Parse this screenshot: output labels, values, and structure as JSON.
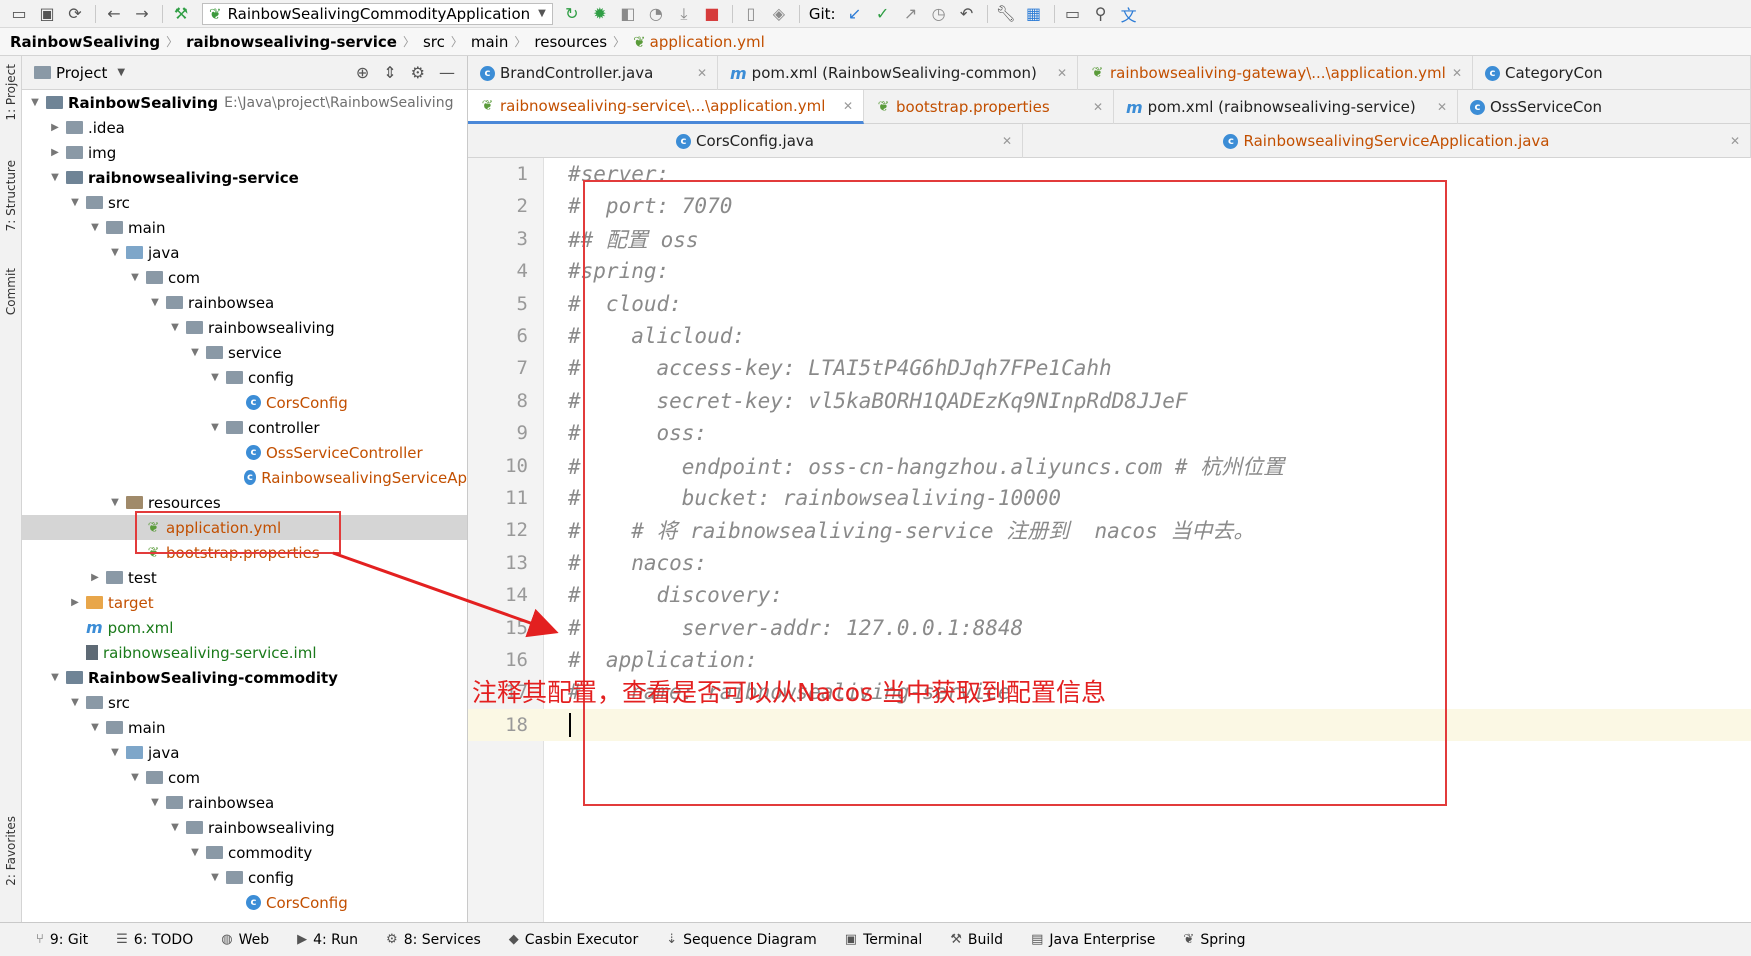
{
  "toolbar": {
    "run_config": "RainbowSealivingCommodityApplication",
    "git_label": "Git:"
  },
  "breadcrumb": [
    "RainbowSealiving",
    "raibnowsealiving-service",
    "src",
    "main",
    "resources",
    "application.yml"
  ],
  "left_stripe": {
    "project": "1: Project",
    "structure": "7: Structure",
    "commit": "Commit",
    "favorites": "2: Favorites"
  },
  "project_panel": {
    "title": "Project",
    "tree": [
      {
        "label": "RainbowSealiving",
        "path": "E:\\Java\\project\\RainbowSealiving",
        "level": 0,
        "arrow": "down",
        "icon": "module-folder",
        "style": "bold"
      },
      {
        "label": ".idea",
        "level": 1,
        "arrow": "right",
        "icon": "folder"
      },
      {
        "label": "img",
        "level": 1,
        "arrow": "right",
        "icon": "folder"
      },
      {
        "label": "raibnowsealiving-service",
        "level": 1,
        "arrow": "down",
        "icon": "module-folder",
        "style": "bold"
      },
      {
        "label": "src",
        "level": 2,
        "arrow": "down",
        "icon": "folder"
      },
      {
        "label": "main",
        "level": 3,
        "arrow": "down",
        "icon": "folder"
      },
      {
        "label": "java",
        "level": 4,
        "arrow": "down",
        "icon": "src-folder"
      },
      {
        "label": "com",
        "level": 5,
        "arrow": "down",
        "icon": "folder"
      },
      {
        "label": "rainbowsea",
        "level": 6,
        "arrow": "down",
        "icon": "folder"
      },
      {
        "label": "rainbowsealiving",
        "level": 7,
        "arrow": "down",
        "icon": "folder"
      },
      {
        "label": "service",
        "level": 8,
        "arrow": "down",
        "icon": "folder"
      },
      {
        "label": "config",
        "level": 9,
        "arrow": "down",
        "icon": "folder"
      },
      {
        "label": "CorsConfig",
        "level": 10,
        "arrow": "",
        "icon": "class",
        "style": "orange"
      },
      {
        "label": "controller",
        "level": 9,
        "arrow": "down",
        "icon": "folder"
      },
      {
        "label": "OssServiceController",
        "level": 10,
        "arrow": "",
        "icon": "class",
        "style": "orange"
      },
      {
        "label": "RainbowsealivingServiceAp",
        "level": 10,
        "arrow": "",
        "icon": "class",
        "style": "orange"
      },
      {
        "label": "resources",
        "level": 4,
        "arrow": "down",
        "icon": "res-folder"
      },
      {
        "label": "application.yml",
        "level": 5,
        "arrow": "",
        "icon": "yml",
        "style": "orange",
        "selected": true
      },
      {
        "label": "bootstrap.properties",
        "level": 5,
        "arrow": "",
        "icon": "yml",
        "style": "orange"
      },
      {
        "label": "test",
        "level": 3,
        "arrow": "right",
        "icon": "folder"
      },
      {
        "label": "target",
        "level": 2,
        "arrow": "right",
        "icon": "target-folder",
        "style": "brown"
      },
      {
        "label": "pom.xml",
        "level": 2,
        "arrow": "",
        "icon": "maven",
        "style": "green"
      },
      {
        "label": "raibnowsealiving-service.iml",
        "level": 2,
        "arrow": "",
        "icon": "iml",
        "style": "green"
      },
      {
        "label": "RainbowSealiving-commodity",
        "level": 1,
        "arrow": "down",
        "icon": "module-folder",
        "style": "bold"
      },
      {
        "label": "src",
        "level": 2,
        "arrow": "down",
        "icon": "folder"
      },
      {
        "label": "main",
        "level": 3,
        "arrow": "down",
        "icon": "folder"
      },
      {
        "label": "java",
        "level": 4,
        "arrow": "down",
        "icon": "src-folder"
      },
      {
        "label": "com",
        "level": 5,
        "arrow": "down",
        "icon": "folder"
      },
      {
        "label": "rainbowsea",
        "level": 6,
        "arrow": "down",
        "icon": "folder"
      },
      {
        "label": "rainbowsealiving",
        "level": 7,
        "arrow": "down",
        "icon": "folder"
      },
      {
        "label": "commodity",
        "level": 8,
        "arrow": "down",
        "icon": "folder"
      },
      {
        "label": "config",
        "level": 9,
        "arrow": "down",
        "icon": "folder"
      },
      {
        "label": "CorsConfig",
        "level": 10,
        "arrow": "",
        "icon": "class",
        "style": "blue"
      }
    ]
  },
  "editor_tabs": {
    "row1": [
      {
        "label": "BrandController.java",
        "icon": "class"
      },
      {
        "label": "pom.xml (RainbowSealiving-common)",
        "icon": "maven"
      },
      {
        "label": "rainbowsealiving-gateway\\...\\application.yml",
        "icon": "yml"
      },
      {
        "label": "CategoryCon",
        "icon": "class"
      }
    ],
    "row2": [
      {
        "label": "raibnowsealiving-service\\...\\application.yml",
        "icon": "yml",
        "active": true
      },
      {
        "label": "bootstrap.properties",
        "icon": "yml"
      },
      {
        "label": "pom.xml (raibnowsealiving-service)",
        "icon": "maven"
      },
      {
        "label": "OssServiceCon",
        "icon": "class"
      }
    ],
    "row3": [
      {
        "label": "CorsConfig.java",
        "icon": "class"
      },
      {
        "label": "RainbowsealivingServiceApplication.java",
        "icon": "class"
      }
    ]
  },
  "editor": {
    "lines": [
      {
        "n": "1",
        "text": "#server:"
      },
      {
        "n": "2",
        "text": "#  port: 7070"
      },
      {
        "n": "3",
        "text": "## 配置 oss"
      },
      {
        "n": "4",
        "text": "#spring:"
      },
      {
        "n": "5",
        "text": "#  cloud:"
      },
      {
        "n": "6",
        "text": "#    alicloud:"
      },
      {
        "n": "7",
        "text": "#      access-key: LTAI5tP4G6hDJqh7FPe1Cahh"
      },
      {
        "n": "8",
        "text": "#      secret-key: vl5kaBORH1QADEzKq9NInpRdD8JJeF"
      },
      {
        "n": "9",
        "text": "#      oss:"
      },
      {
        "n": "10",
        "text": "#        endpoint: oss-cn-hangzhou.aliyuncs.com # 杭州位置"
      },
      {
        "n": "11",
        "text": "#        bucket: rainbowsealiving-10000"
      },
      {
        "n": "12",
        "text": "#    # 将 raibnowsealiving-service 注册到  nacos 当中去。"
      },
      {
        "n": "13",
        "text": "#    nacos:"
      },
      {
        "n": "14",
        "text": "#      discovery:"
      },
      {
        "n": "15",
        "text": "#        server-addr: 127.0.0.1:8848"
      },
      {
        "n": "16",
        "text": "#  application:"
      },
      {
        "n": "17",
        "text": "#    name: raibnowsealiving-service"
      },
      {
        "n": "18",
        "text": ""
      }
    ]
  },
  "annotation": {
    "text": "注释其配置，查看是否可以从Nacos 当中获取到配置信息",
    "color": "#e32020"
  },
  "bottom_bar": [
    {
      "label": "9: Git",
      "icon": "git-icon"
    },
    {
      "label": "6: TODO",
      "icon": "todo-icon"
    },
    {
      "label": "Web",
      "icon": "web-icon"
    },
    {
      "label": "4: Run",
      "icon": "run-icon"
    },
    {
      "label": "8: Services",
      "icon": "services-icon"
    },
    {
      "label": "Casbin Executor",
      "icon": "casbin-icon"
    },
    {
      "label": "Sequence Diagram",
      "icon": "sequence-icon"
    },
    {
      "label": "Terminal",
      "icon": "terminal-icon"
    },
    {
      "label": "Build",
      "icon": "build-icon"
    },
    {
      "label": "Java Enterprise",
      "icon": "java-enterprise-icon"
    },
    {
      "label": "Spring",
      "icon": "spring-icon"
    }
  ]
}
